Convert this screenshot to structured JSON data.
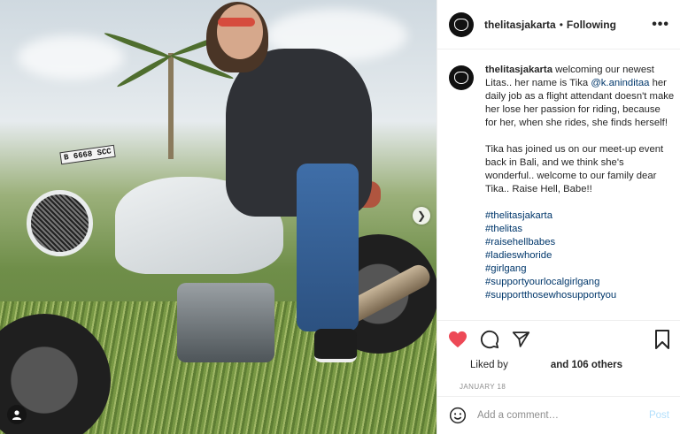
{
  "photo": {
    "plate_text": "B 6668 SCC"
  },
  "header": {
    "username": "thelitasjakarta",
    "separator": "•",
    "follow_status": "Following",
    "more_icon": "more-horizontal-icon"
  },
  "caption": {
    "username": "thelitasjakarta",
    "text_before_mention": "welcoming our newest Litas.. her name is Tika",
    "mention": "@k.aninditaa",
    "text_after_mention": "her daily job as a flight attendant doesn't make her lose her passion for riding, because for her, when she rides, she finds herself!",
    "paragraph2": "Tika has joined us on our meet-up event back in Bali, and we think she's wonderful.. welcome to our family dear Tika.. Raise Hell, Babe!!",
    "hashtags": [
      "#thelitasjakarta",
      "#thelitas",
      "#raisehellbabes",
      "#ladieswhoride",
      "#girlgang",
      "#supportyourlocalgirlgang",
      "#supportthosewhosupportyou"
    ]
  },
  "actions": {
    "like_color": "#ed4956",
    "liked_by_label": "Liked by",
    "others_label": "and 106 others",
    "date": "JANUARY 18"
  },
  "comment": {
    "placeholder": "Add a comment…",
    "post_label": "Post",
    "post_color": "#b2dffc"
  }
}
